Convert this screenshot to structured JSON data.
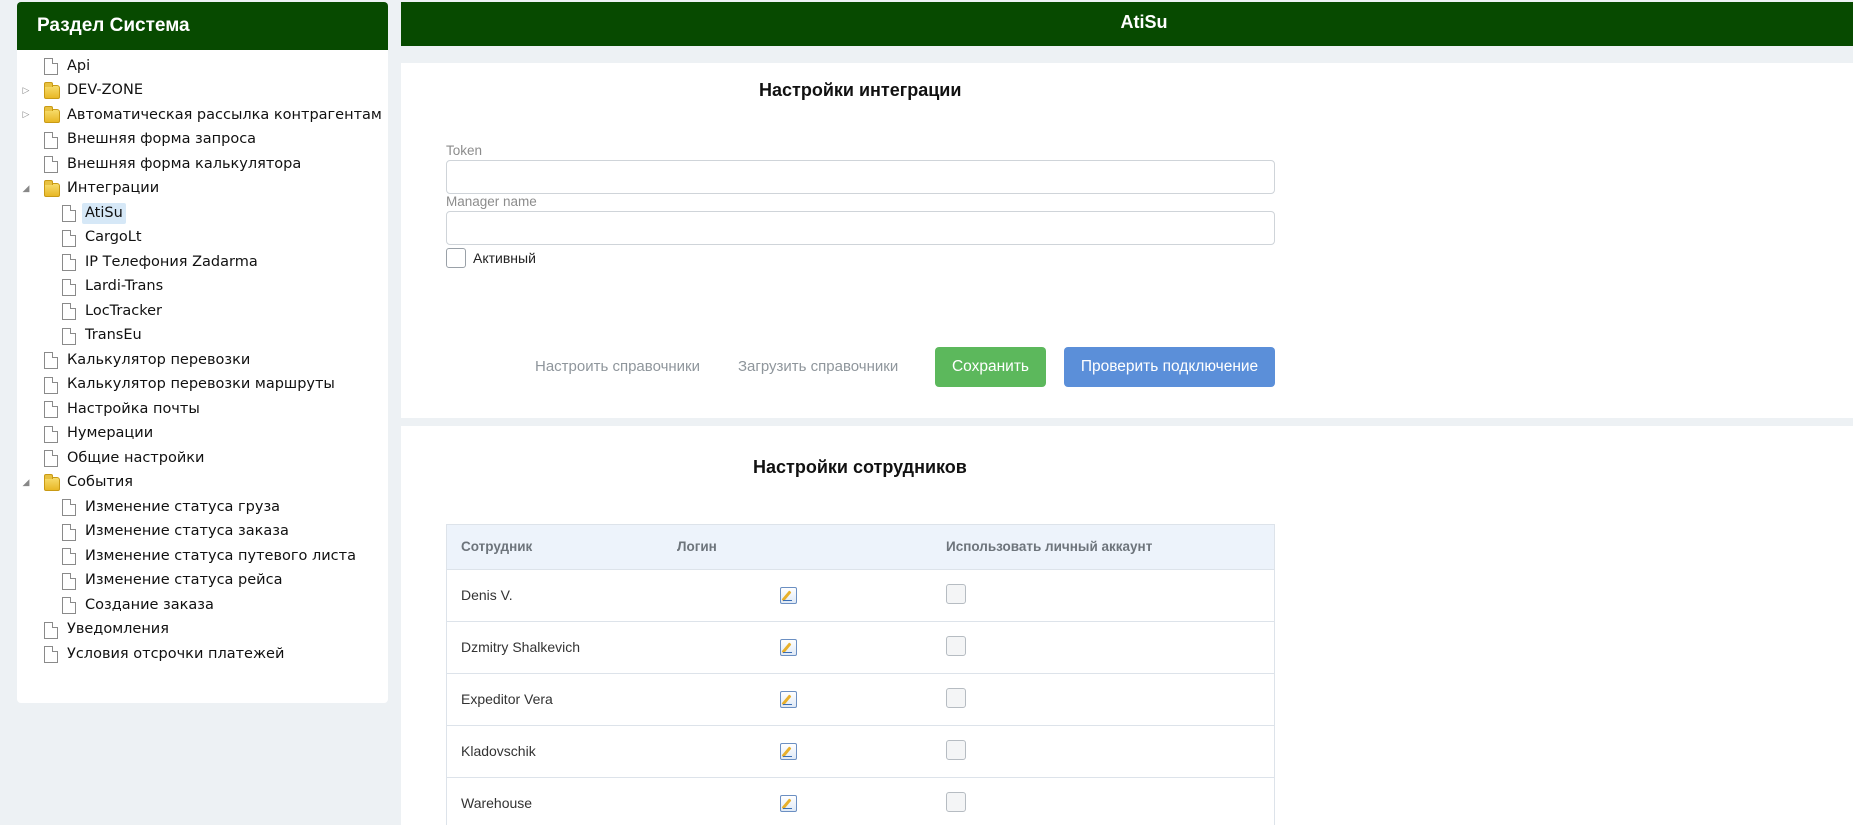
{
  "sidebar": {
    "title": "Раздел Система",
    "items": [
      {
        "label": "Api",
        "type": "file",
        "level": 0,
        "toggle": ""
      },
      {
        "label": "DEV-ZONE",
        "type": "folder",
        "level": 0,
        "toggle": "collapsed"
      },
      {
        "label": "Автоматическая рассылка контрагентам",
        "type": "folder",
        "level": 0,
        "toggle": "collapsed"
      },
      {
        "label": "Внешняя форма запроса",
        "type": "file",
        "level": 0,
        "toggle": ""
      },
      {
        "label": "Внешняя форма калькулятора",
        "type": "file",
        "level": 0,
        "toggle": ""
      },
      {
        "label": "Интеграции",
        "type": "folder",
        "level": 0,
        "toggle": "expanded"
      },
      {
        "label": "AtiSu",
        "type": "file",
        "level": 1,
        "toggle": "",
        "selected": true
      },
      {
        "label": "CargoLt",
        "type": "file",
        "level": 1,
        "toggle": ""
      },
      {
        "label": "IP Телефония Zadarma",
        "type": "file",
        "level": 1,
        "toggle": ""
      },
      {
        "label": "Lardi-Trans",
        "type": "file",
        "level": 1,
        "toggle": ""
      },
      {
        "label": "LocTracker",
        "type": "file",
        "level": 1,
        "toggle": ""
      },
      {
        "label": "TransEu",
        "type": "file",
        "level": 1,
        "toggle": ""
      },
      {
        "label": "Калькулятор перевозки",
        "type": "file",
        "level": 0,
        "toggle": ""
      },
      {
        "label": "Калькулятор перевозки маршруты",
        "type": "file",
        "level": 0,
        "toggle": ""
      },
      {
        "label": "Настройка почты",
        "type": "file",
        "level": 0,
        "toggle": ""
      },
      {
        "label": "Нумерации",
        "type": "file",
        "level": 0,
        "toggle": ""
      },
      {
        "label": "Общие настройки",
        "type": "file",
        "level": 0,
        "toggle": ""
      },
      {
        "label": "События",
        "type": "folder",
        "level": 0,
        "toggle": "expanded"
      },
      {
        "label": "Изменение статуса груза",
        "type": "file",
        "level": 1,
        "toggle": ""
      },
      {
        "label": "Изменение статуса заказа",
        "type": "file",
        "level": 1,
        "toggle": ""
      },
      {
        "label": "Изменение статуса путевого листа",
        "type": "file",
        "level": 1,
        "toggle": ""
      },
      {
        "label": "Изменение статуса рейса",
        "type": "file",
        "level": 1,
        "toggle": ""
      },
      {
        "label": "Создание заказа",
        "type": "file",
        "level": 1,
        "toggle": ""
      },
      {
        "label": "Уведомления",
        "type": "file",
        "level": 0,
        "toggle": ""
      },
      {
        "label": "Условия отсрочки платежей",
        "type": "file",
        "level": 0,
        "toggle": ""
      }
    ]
  },
  "header": {
    "title": "AtiSu"
  },
  "integration": {
    "title": "Настройки интеграции",
    "token_label": "Token",
    "token_value": "",
    "manager_label": "Manager name",
    "manager_value": "",
    "active_label": "Активный",
    "active_checked": false,
    "configure_refs_label": "Настроить справочники",
    "load_refs_label": "Загрузить справочники",
    "save_label": "Сохранить",
    "check_connection_label": "Проверить подключение",
    "colors": {
      "save": "#5cb85c",
      "check": "#5b8fd9",
      "header": "#074a00"
    }
  },
  "staff": {
    "title": "Настройки сотрудников",
    "columns": [
      "Сотрудник",
      "Логин",
      "Использовать личный аккаунт"
    ],
    "rows": [
      {
        "name": "Denis V.",
        "use_personal": false
      },
      {
        "name": "Dzmitry Shalkevich",
        "use_personal": false
      },
      {
        "name": "Expeditor Vera",
        "use_personal": false
      },
      {
        "name": "Kladovschik",
        "use_personal": false
      },
      {
        "name": "Warehouse",
        "use_personal": false
      }
    ]
  }
}
